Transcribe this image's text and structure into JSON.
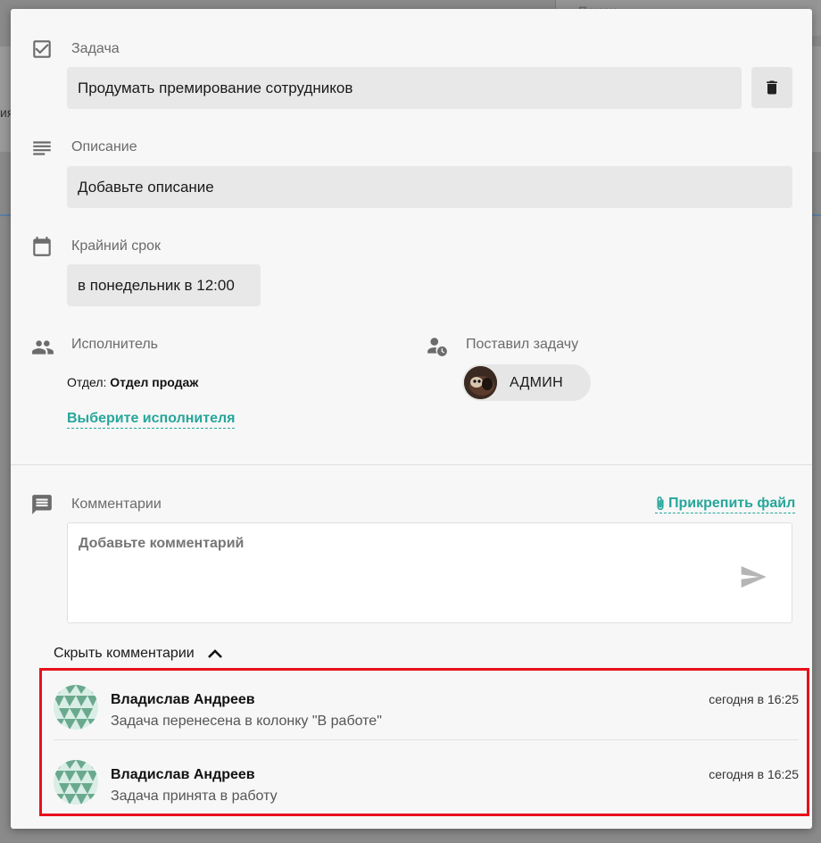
{
  "background": {
    "search_text": "Поиск",
    "side_text": "ия"
  },
  "task": {
    "label": "Задача",
    "value": "Продумать премирование сотрудников"
  },
  "description": {
    "label": "Описание",
    "value": "Добавьте описание"
  },
  "deadline": {
    "label": "Крайний срок",
    "value": "в понедельник в 12:00"
  },
  "assignee": {
    "label": "Исполнитель",
    "dept_prefix": "Отдел:",
    "dept_name": "Отдел продаж",
    "choose_link": "Выберите исполнителя"
  },
  "assigner": {
    "label": "Поставил задачу",
    "name": "АДМИН"
  },
  "comments": {
    "label": "Комментарии",
    "attach_link": "Прикрепить файл",
    "input_placeholder": "Добавьте комментарий",
    "toggle_label": "Скрыть комментарии",
    "items": [
      {
        "author": "Владислав Андреев",
        "time": "сегодня в 16:25",
        "text": "Задача перенесена в колонку \"В работе\""
      },
      {
        "author": "Владислав Андреев",
        "time": "сегодня в 16:25",
        "text": "Задача принята в работу"
      }
    ]
  },
  "colors": {
    "accent": "#26a69a",
    "highlight": "#e8111b",
    "field_bg": "#e8e8e8"
  }
}
